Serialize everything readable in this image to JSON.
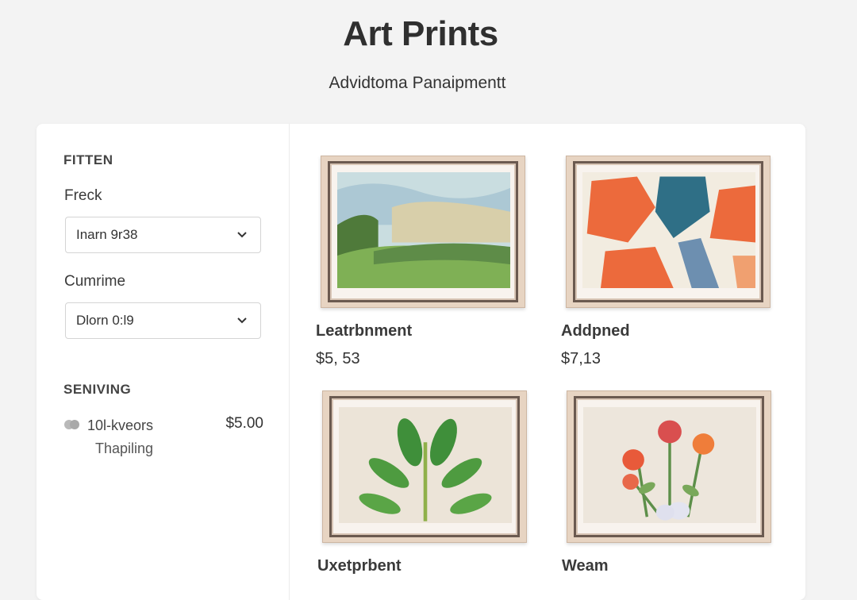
{
  "header": {
    "title": "Art Prints",
    "subtitle": "Advidtoma Panaipmentt"
  },
  "sidebar": {
    "filter_heading": "FITTEN",
    "filters": [
      {
        "label": "Freck",
        "value": "Inarn 9r38"
      },
      {
        "label": "Cumrime",
        "value": "Dlorn 0:l9"
      }
    ],
    "shipping_heading": "SENIVING",
    "shipping": {
      "name": "10l-kveors",
      "sub": "Thapiling",
      "price": "$5.00"
    }
  },
  "products": [
    {
      "title": "Leatrbnment",
      "price": "$5, 53",
      "art": "landscape-painting"
    },
    {
      "title": "Addpned",
      "price": "$7,13",
      "art": "abstract-painting"
    },
    {
      "title": "Uxetprbent",
      "price": "",
      "art": "leaf-painting"
    },
    {
      "title": "Weam",
      "price": "",
      "art": "flower-painting"
    }
  ],
  "colors": {
    "background": "#f3f3f3",
    "panel": "#ffffff",
    "frame": "#e7d4c2",
    "accent_orange": "#ec6a3c",
    "accent_teal": "#2f6f86"
  }
}
